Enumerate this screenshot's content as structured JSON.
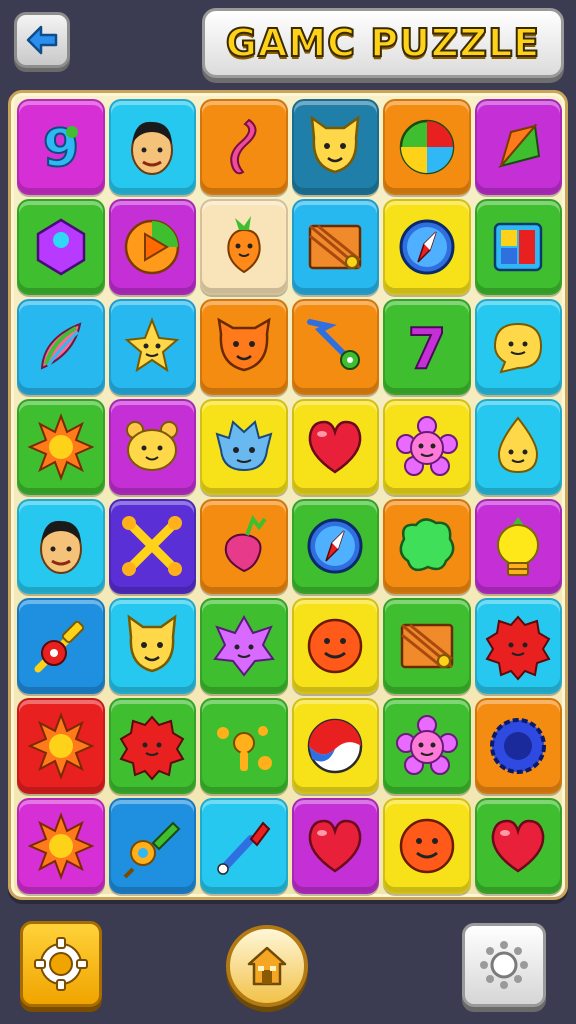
{
  "header": {
    "title": "GAMC PUZZLE",
    "back_icon": "arrow-left-icon"
  },
  "footer": {
    "left_icon": "gear-icon",
    "center_icon": "home-icon",
    "right_icon": "settings-sun-icon"
  },
  "colors": {
    "background": "#3b3b52",
    "title_fill": "#ffd21a",
    "board": "#f7f0c8"
  },
  "board": {
    "rows": 8,
    "cols": 6,
    "tiles": [
      {
        "bg": "#d62fd6",
        "icon": "number-nine-icon"
      },
      {
        "bg": "#27c8ef",
        "icon": "face-icon"
      },
      {
        "bg": "#f58c12",
        "icon": "swirl-icon"
      },
      {
        "bg": "#1f7fa8",
        "icon": "cat-icon"
      },
      {
        "bg": "#f58c12",
        "icon": "pie-chart-icon"
      },
      {
        "bg": "#c52fd6",
        "icon": "kite-icon"
      },
      {
        "bg": "#3fbf2f",
        "icon": "gem-icon"
      },
      {
        "bg": "#c52fd6",
        "icon": "play-circle-icon"
      },
      {
        "bg": "#f9e3b8",
        "icon": "carrot-icon"
      },
      {
        "bg": "#27b8ef",
        "icon": "crate-icon"
      },
      {
        "bg": "#f7e21a",
        "icon": "compass-icon"
      },
      {
        "bg": "#3fbf2f",
        "icon": "window-icon"
      },
      {
        "bg": "#27b8ef",
        "icon": "feather-icon"
      },
      {
        "bg": "#27b8ef",
        "icon": "star-face-icon"
      },
      {
        "bg": "#f58c12",
        "icon": "fox-icon"
      },
      {
        "bg": "#f58c12",
        "icon": "arrow-icon"
      },
      {
        "bg": "#3fbf2f",
        "icon": "number-seven-icon"
      },
      {
        "bg": "#27c8ef",
        "icon": "blob-face-icon"
      },
      {
        "bg": "#3fbf2f",
        "icon": "sun-icon"
      },
      {
        "bg": "#c52fd6",
        "icon": "bear-icon"
      },
      {
        "bg": "#f7e21a",
        "icon": "monster-icon"
      },
      {
        "bg": "#f7e21a",
        "icon": "heart-icon"
      },
      {
        "bg": "#f7e21a",
        "icon": "flower-face-icon"
      },
      {
        "bg": "#27c8ef",
        "icon": "drop-face-icon"
      },
      {
        "bg": "#27c8ef",
        "icon": "face-icon"
      },
      {
        "bg": "#5a2fd6",
        "icon": "bones-icon"
      },
      {
        "bg": "#f58c12",
        "icon": "radish-icon"
      },
      {
        "bg": "#3fbf2f",
        "icon": "compass-icon"
      },
      {
        "bg": "#f58c12",
        "icon": "splat-icon"
      },
      {
        "bg": "#c52fd6",
        "icon": "lightbulb-icon"
      },
      {
        "bg": "#1f8fe0",
        "icon": "key-icon"
      },
      {
        "bg": "#27c8ef",
        "icon": "cat-icon"
      },
      {
        "bg": "#3fbf2f",
        "icon": "spiky-monster-icon"
      },
      {
        "bg": "#f7e21a",
        "icon": "smiley-icon"
      },
      {
        "bg": "#3fbf2f",
        "icon": "crate-icon"
      },
      {
        "bg": "#27c8ef",
        "icon": "gear-face-icon"
      },
      {
        "bg": "#e82020",
        "icon": "sun-icon"
      },
      {
        "bg": "#3fbf2f",
        "icon": "gear-face-icon"
      },
      {
        "bg": "#3fbf2f",
        "icon": "blob-icon"
      },
      {
        "bg": "#f7e21a",
        "icon": "ball-icon"
      },
      {
        "bg": "#3fbf2f",
        "icon": "flower-face-icon"
      },
      {
        "bg": "#f58c12",
        "icon": "cog-ring-icon"
      },
      {
        "bg": "#d62fd6",
        "icon": "sun-icon"
      },
      {
        "bg": "#1f8fe0",
        "icon": "shovel-icon"
      },
      {
        "bg": "#27c8ef",
        "icon": "brush-icon"
      },
      {
        "bg": "#c52fd6",
        "icon": "heart-icon"
      },
      {
        "bg": "#f7e21a",
        "icon": "smiley-icon"
      },
      {
        "bg": "#3fbf2f",
        "icon": "heart-icon"
      }
    ]
  }
}
